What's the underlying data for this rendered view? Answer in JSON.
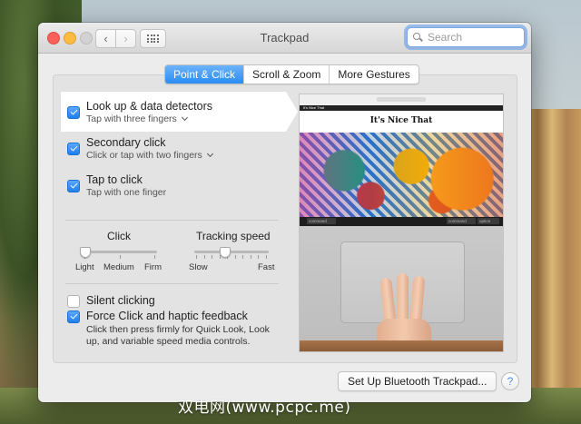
{
  "window": {
    "title": "Trackpad"
  },
  "toolbar": {
    "back_icon": "chevron-left-icon",
    "forward_icon": "chevron-right-icon",
    "grid_icon": "grid-icon"
  },
  "search": {
    "placeholder": "Search",
    "value": ""
  },
  "tabs": [
    {
      "label": "Point & Click",
      "active": true
    },
    {
      "label": "Scroll & Zoom",
      "active": false
    },
    {
      "label": "More Gestures",
      "active": false
    }
  ],
  "gestures": [
    {
      "title": "Look up & data detectors",
      "subtitle": "Tap with three fingers",
      "checked": true,
      "has_menu": true
    },
    {
      "title": "Secondary click",
      "subtitle": "Click or tap with two fingers",
      "checked": true,
      "has_menu": true
    },
    {
      "title": "Tap to click",
      "subtitle": "Tap with one finger",
      "checked": true,
      "has_menu": false
    }
  ],
  "click_slider": {
    "label": "Click",
    "ticks": [
      "Light",
      "Medium",
      "Firm"
    ],
    "value_fraction": 0.0
  },
  "tracking_slider": {
    "label": "Tracking speed",
    "min_label": "Slow",
    "max_label": "Fast",
    "value_fraction": 0.4
  },
  "options": {
    "silent_clicking": {
      "label": "Silent clicking",
      "checked": false
    },
    "force_click": {
      "label": "Force Click and haptic feedback",
      "checked": true,
      "description": "Click then press firmly for Quick Look, Look up, and variable speed media controls."
    }
  },
  "preview": {
    "site_title": "It's Nice That",
    "nav_text": "It's Nice That",
    "keys": [
      "command",
      "command",
      "option"
    ]
  },
  "footer": {
    "bluetooth_button": "Set Up Bluetooth Trackpad...",
    "help_label": "?"
  },
  "watermark": "双电网(www.pcpc.me)",
  "colors": {
    "accent": "#2a8cf4",
    "close": "#fc605c",
    "minimize": "#fdbc40"
  }
}
